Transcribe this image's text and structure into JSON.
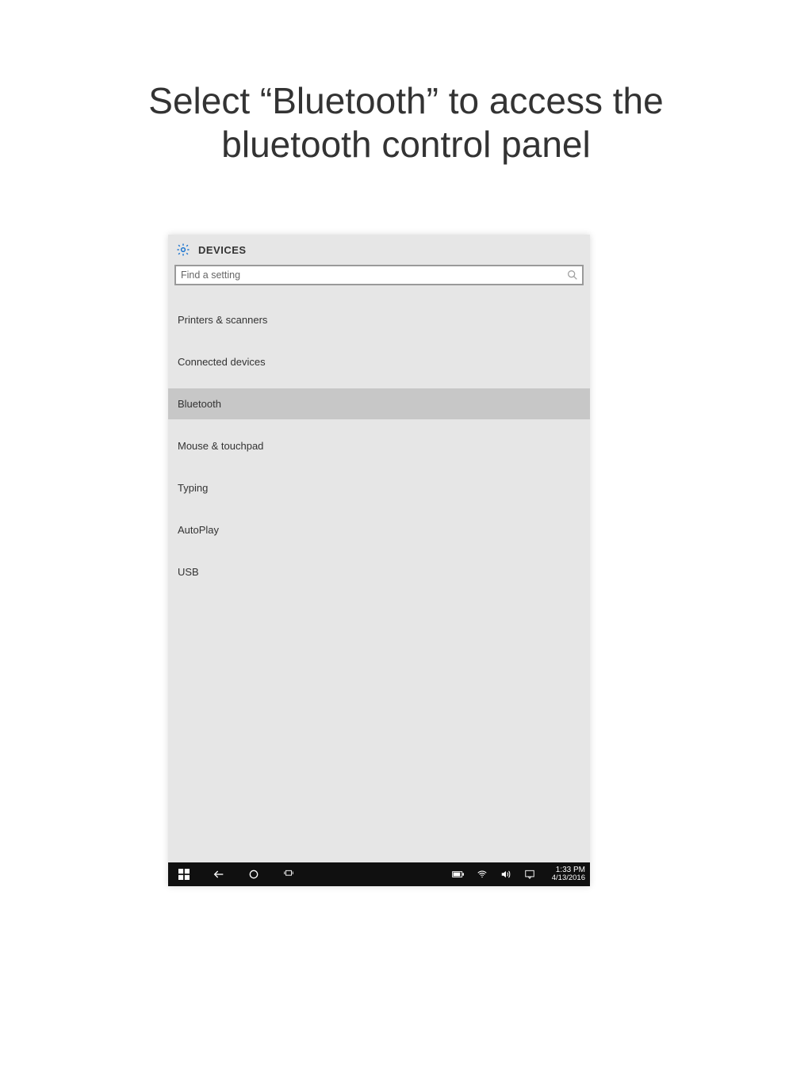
{
  "slide": {
    "title": "Select “Bluetooth” to access the bluetooth control panel"
  },
  "settings": {
    "header_title": "DEVICES",
    "search_placeholder": "Find a setting",
    "nav": [
      {
        "label": "Printers & scanners",
        "selected": false
      },
      {
        "label": "Connected devices",
        "selected": false
      },
      {
        "label": "Bluetooth",
        "selected": true
      },
      {
        "label": "Mouse & touchpad",
        "selected": false
      },
      {
        "label": "Typing",
        "selected": false
      },
      {
        "label": "AutoPlay",
        "selected": false
      },
      {
        "label": "USB",
        "selected": false
      }
    ]
  },
  "taskbar": {
    "time": "1:33 PM",
    "date": "4/13/2016"
  }
}
